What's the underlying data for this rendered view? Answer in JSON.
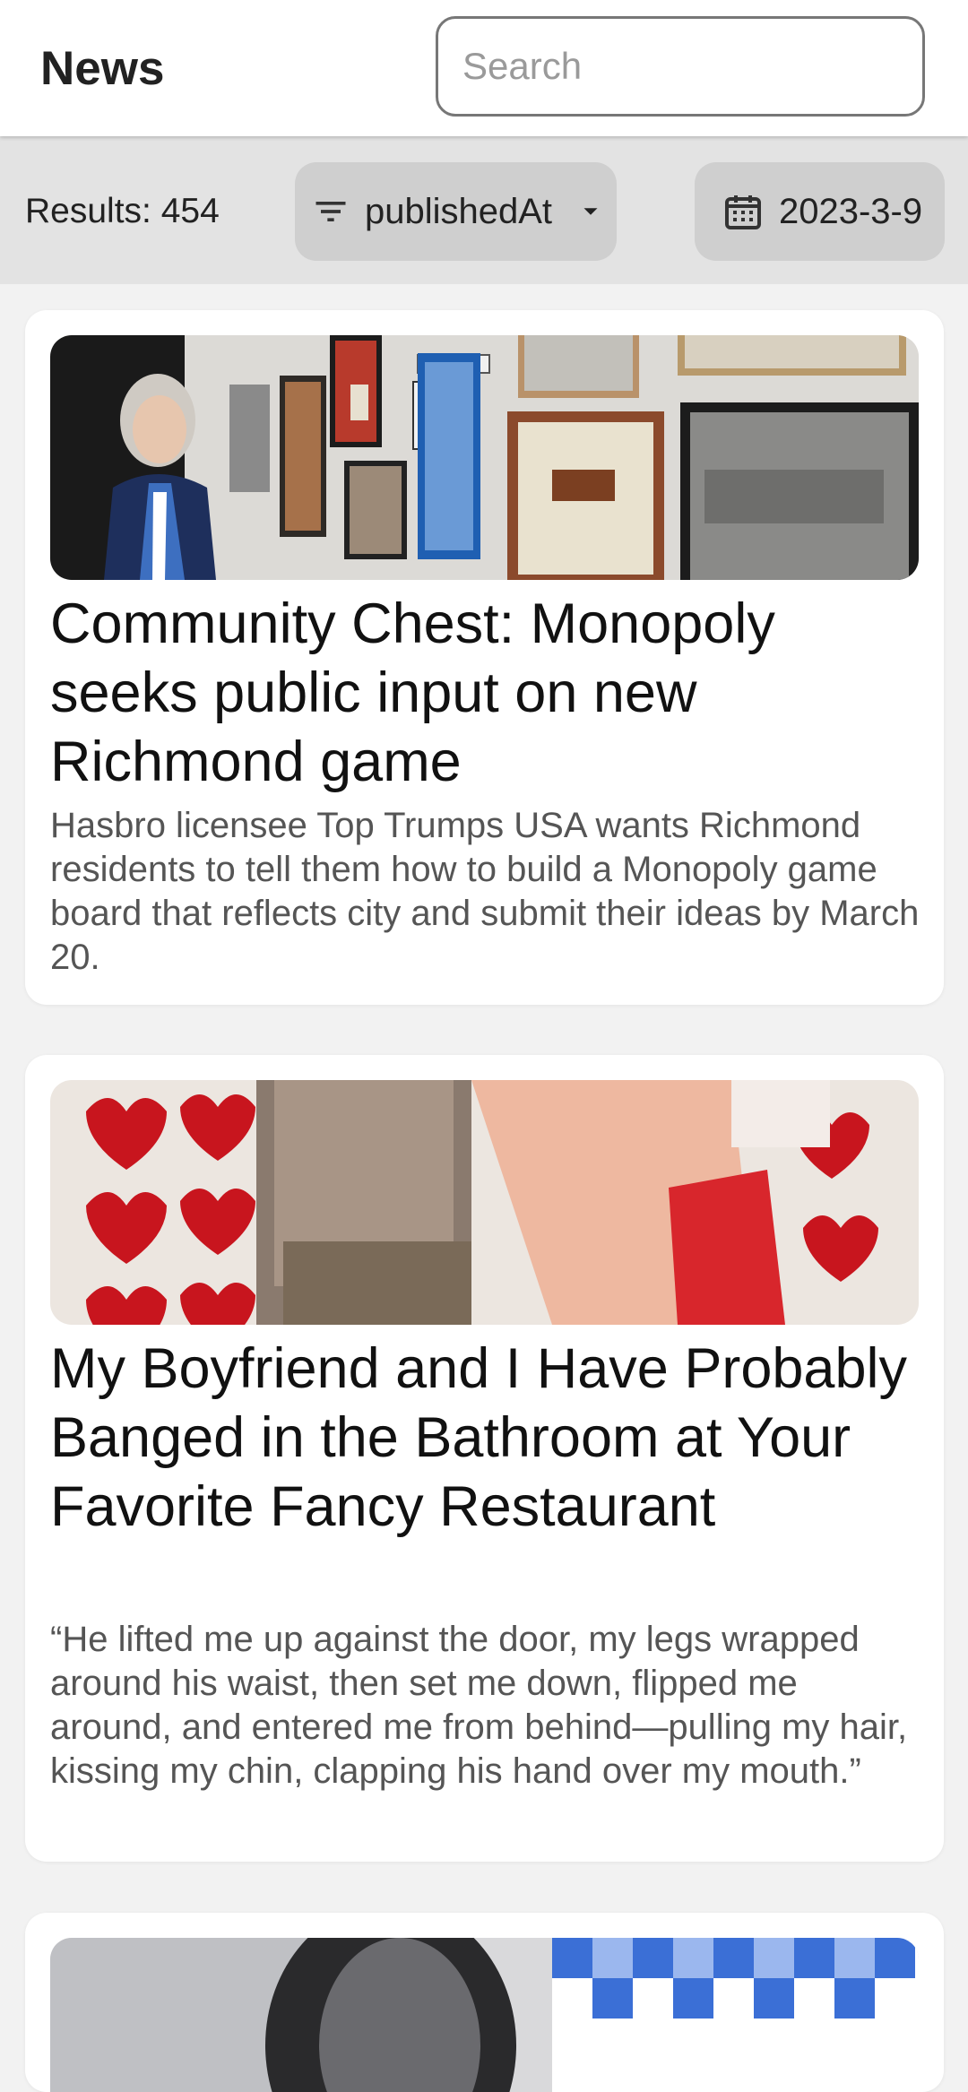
{
  "header": {
    "title": "News",
    "search_placeholder": "Search",
    "search_value": ""
  },
  "filters": {
    "results_text": "Results: 454",
    "sort_label": "publishedAt",
    "date_label": "2023-3-9"
  },
  "icons": {
    "sort": "filter-list-icon",
    "dropdown": "arrow-drop-down-icon",
    "date": "calendar-icon"
  },
  "articles": [
    {
      "title": "Community Chest: Monopoly seeks public input on new Richmond game",
      "description": "Hasbro licensee Top Trumps USA wants Richmond residents to tell them how to build a Monopoly game board that reflects city and submit their ideas by March 20."
    },
    {
      "title": "My Boyfriend and I Have Probably Banged in the Bathroom at Your Favorite Fancy Restaurant",
      "description": "“He lifted me up against the door, my legs wrapped around his waist, then set me down, flipped me around, and entered me from behind—pulling my hair, kissing my chin, clapping his hand over my mouth.”"
    }
  ]
}
